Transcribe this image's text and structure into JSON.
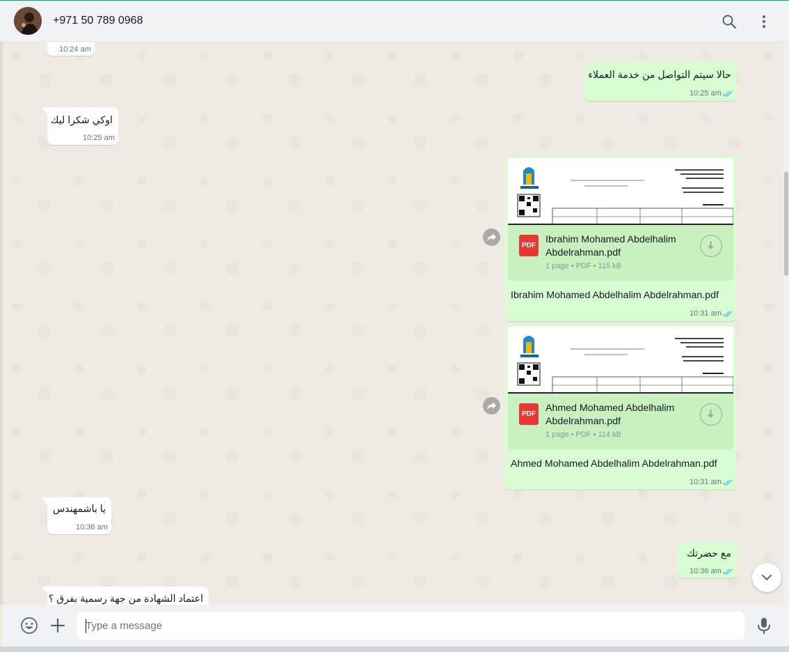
{
  "header": {
    "contact_name": "+971 50 789 0968",
    "avatar_alt": "contact avatar",
    "icons": [
      "search-icon",
      "menu-icon"
    ]
  },
  "messages": [
    {
      "direction": "in",
      "text": "",
      "time": "10:24 am"
    },
    {
      "direction": "out",
      "text": "حالا سيتم التواصل من خدمة العملاء",
      "time": "10:25 am",
      "status": "read"
    },
    {
      "direction": "in",
      "text": "اوكي شكرا ليك",
      "time": "10:25 am"
    },
    {
      "direction": "out",
      "type": "document",
      "file_name": "Ibrahim Mohamed Abdelhalim Abdelrahman.pdf",
      "file_name_line1": "Ibrahim Mohamed Abdelhalim",
      "file_name_line2": "Abdelrahman.pdf",
      "meta": "1 page • PDF • 115 kB",
      "badge": "PDF",
      "caption": "Ibrahim Mohamed Abdelhalim Abdelrahman.pdf",
      "time": "10:31 am",
      "status": "read"
    },
    {
      "direction": "out",
      "type": "document",
      "file_name": "Ahmed Mohamed Abdelhalim Abdelrahman.pdf",
      "file_name_line1": "Ahmed Mohamed Abdelhalim",
      "file_name_line2": "Abdelrahman.pdf",
      "meta": "1 page • PDF • 114 kB",
      "badge": "PDF",
      "caption": "Ahmed Mohamed Abdelhalim Abdelrahman.pdf",
      "time": "10:31 am",
      "status": "read"
    },
    {
      "direction": "in",
      "text": "يا باشمهندس",
      "time": "10:36 am"
    },
    {
      "direction": "out",
      "text": "مع حضرتك",
      "time": "10:36 am",
      "status": "read"
    },
    {
      "direction": "in",
      "text": "اعتماد الشهادة من جهة رسمية بفرق ؟",
      "time": ""
    }
  ],
  "composer": {
    "placeholder": "Type a message",
    "icons": [
      "emoji-icon",
      "plus-icon",
      "microphone-icon"
    ]
  },
  "colors": {
    "accent": "#00a884",
    "outgoing_bubble": "#d9fdd3",
    "incoming_bubble": "#ffffff",
    "chat_background": "#efeae2",
    "read_ticks": "#53bdeb",
    "pdf_badge": "#e53935"
  }
}
